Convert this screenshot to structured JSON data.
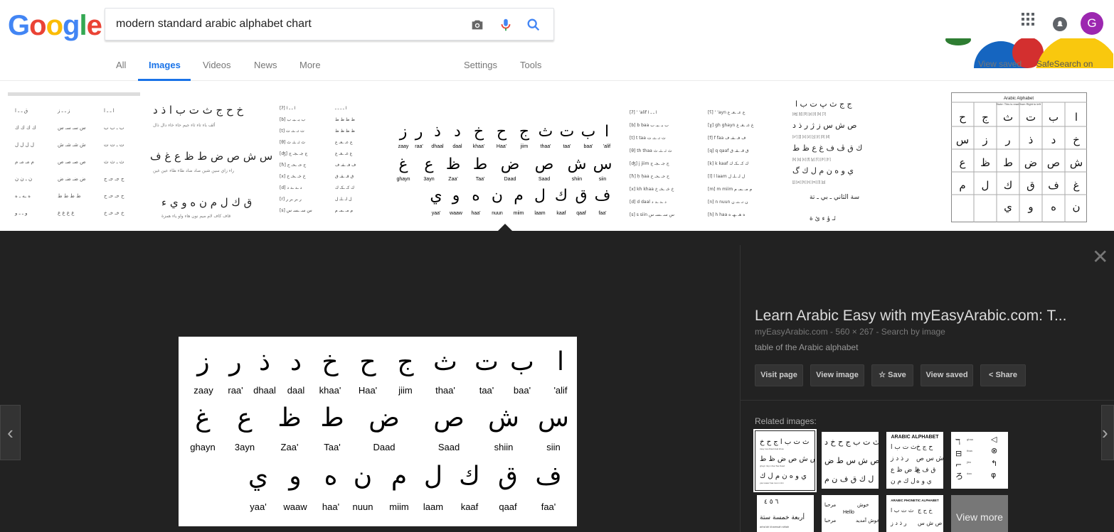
{
  "search": {
    "query": "modern standard arabic alphabet chart",
    "camera_icon": "camera-icon",
    "mic_icon": "mic-icon",
    "search_icon": "search-icon"
  },
  "logo": {
    "letters": [
      "G",
      "o",
      "o",
      "g",
      "l",
      "e"
    ],
    "colors": [
      "#4285F4",
      "#EA4335",
      "#FBBC05",
      "#4285F4",
      "#34A853",
      "#EA4335"
    ]
  },
  "tabs": {
    "all": "All",
    "images": "Images",
    "videos": "Videos",
    "news": "News",
    "more": "More",
    "settings": "Settings",
    "tools": "Tools"
  },
  "account": {
    "avatar_letter": "G",
    "apps_icon": "apps-grid-icon",
    "notifications_icon": "bell-icon"
  },
  "doodle": {
    "view_saved": "View saved",
    "safesearch": "SafeSearch on"
  },
  "main_image": {
    "row1": {
      "letters": [
        "ا",
        "ب",
        "ت",
        "ث",
        "ج",
        "ح",
        "خ",
        "د",
        "ذ",
        "ر",
        "ز"
      ],
      "names": [
        "'alif",
        "baa'",
        "taa'",
        "thaa'",
        "jiim",
        "Haa'",
        "khaa'",
        "daal",
        "dhaal",
        "raa'",
        "zaay"
      ]
    },
    "row2": {
      "letters": [
        "س",
        "ش",
        "ص",
        "ض",
        "ط",
        "ظ",
        "ع",
        "غ"
      ],
      "names": [
        "siin",
        "shiin",
        "Saad",
        "Daad",
        "Taa'",
        "Zaa'",
        "3ayn",
        "ghayn"
      ]
    },
    "row3": {
      "letters": [
        "ف",
        "ق",
        "ك",
        "ل",
        "م",
        "ن",
        "ه",
        "و",
        "ي"
      ],
      "names": [
        "faa'",
        "qaaf",
        "kaaf",
        "laam",
        "miim",
        "nuun",
        "haa'",
        "waaw",
        "yaa'"
      ]
    }
  },
  "panel": {
    "title": "Learn Arabic Easy with myEasyArabic.com: T...",
    "source": "myEasyArabic.com",
    "dimensions": "560 × 267",
    "search_by_image": "Search by image",
    "separator": "-",
    "description": "table of the Arabic alphabet",
    "buttons": {
      "visit_page": "Visit page",
      "view_image": "View image",
      "save": "Save",
      "view_saved": "View saved",
      "share": "Share"
    },
    "related_label": "Related images:",
    "related_thumb_titles": {
      "t3": "ARABIC ALPHABET",
      "t6": "Hello",
      "t7": "ARABIC PHONETIC ALPHABET"
    },
    "view_more": "View more"
  },
  "strip_thumbs": {
    "arabic_alphabet_title": "Arabic Alphabet",
    "arabic_alphabet_subtitle": "Note: This is read from Right to left"
  }
}
